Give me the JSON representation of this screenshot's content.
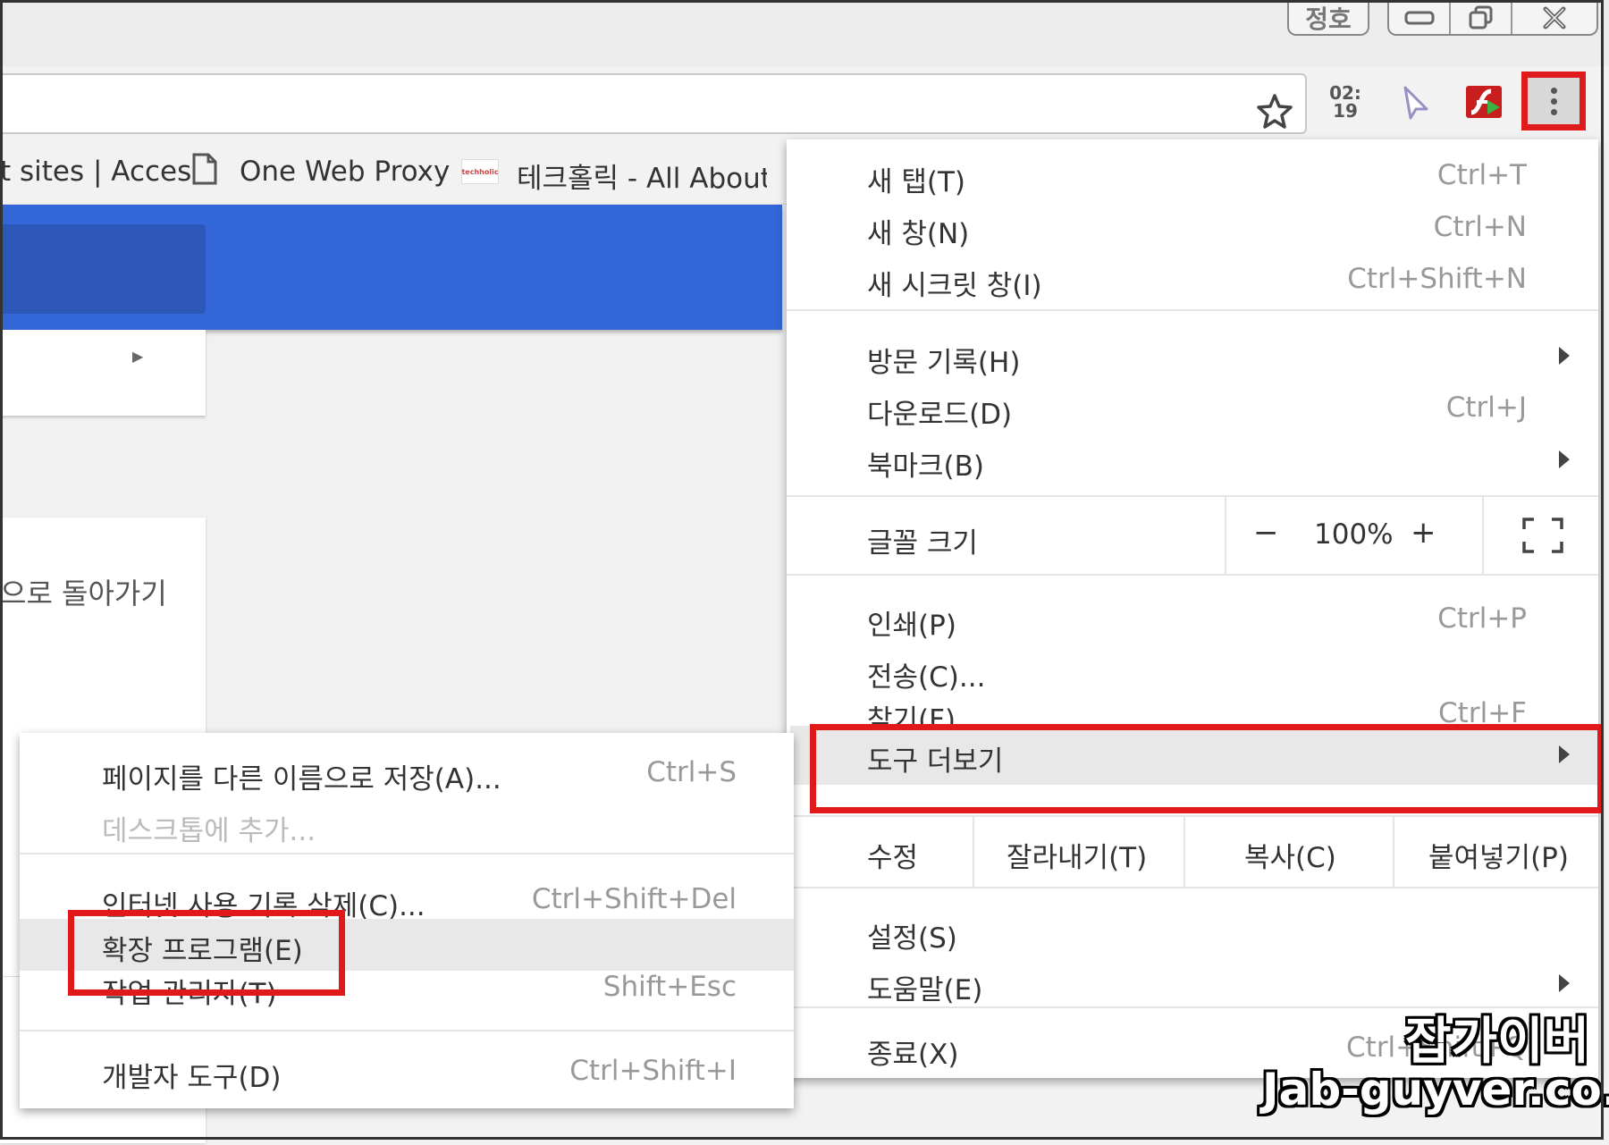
{
  "titlebar": {
    "user_button": "정호",
    "minimize_label": "",
    "restore_label": "",
    "close_label": ""
  },
  "toolbar": {
    "clock_ext_top": "02:",
    "clock_ext_bottom": "19"
  },
  "bookmarks": {
    "item1": "t sites | Acces",
    "item2": "One Web Proxy",
    "item3_logo": "techholic",
    "item3": "테크홀릭 - All About"
  },
  "page": {
    "back_text": "으로 돌아가기"
  },
  "menu": {
    "new_tab": {
      "label": "새 탭(T)",
      "shortcut": "Ctrl+T"
    },
    "new_window": {
      "label": "새 창(N)",
      "shortcut": "Ctrl+N"
    },
    "incognito": {
      "label": "새 시크릿 창(I)",
      "shortcut": "Ctrl+Shift+N"
    },
    "history": {
      "label": "방문 기록(H)"
    },
    "downloads": {
      "label": "다운로드(D)",
      "shortcut": "Ctrl+J"
    },
    "bookmarks": {
      "label": "북마크(B)"
    },
    "zoom": {
      "label": "글꼴 크기",
      "minus": "−",
      "value": "100%",
      "plus": "+"
    },
    "print": {
      "label": "인쇄(P)",
      "shortcut": "Ctrl+P"
    },
    "cast": {
      "label": "전송(C)..."
    },
    "find": {
      "label": "찾기(F)",
      "shortcut": "Ctrl+F"
    },
    "more_tools": {
      "label": "도구 더보기"
    },
    "edit": {
      "label": "수정",
      "cut": "잘라내기(T)",
      "copy": "복사(C)",
      "paste": "붙여넣기(P)"
    },
    "settings": {
      "label": "설정(S)"
    },
    "help": {
      "label": "도움말(E)"
    },
    "exit": {
      "label": "종료(X)",
      "shortcut": "Ctrl+Shift+Q"
    }
  },
  "submenu": {
    "save_page": {
      "label": "페이지를 다른 이름으로 저장(A)...",
      "shortcut": "Ctrl+S"
    },
    "add_desktop": {
      "label": "데스크톱에 추가..."
    },
    "clear_data": {
      "label": "인터넷 사용 기록 삭제(C)...",
      "shortcut": "Ctrl+Shift+Del"
    },
    "extensions": {
      "label": "확장 프로그램(E)"
    },
    "task_manager": {
      "label": "작업 관리자(T)",
      "shortcut": "Shift+Esc"
    },
    "dev_tools": {
      "label": "개발자 도구(D)",
      "shortcut": "Ctrl+Shift+I"
    }
  },
  "watermark": {
    "line1": "잡가이버",
    "line2": "Jab-guyver.co.kr"
  },
  "colors": {
    "highlight_red": "#e01a1a",
    "header_blue": "#3366d6"
  }
}
